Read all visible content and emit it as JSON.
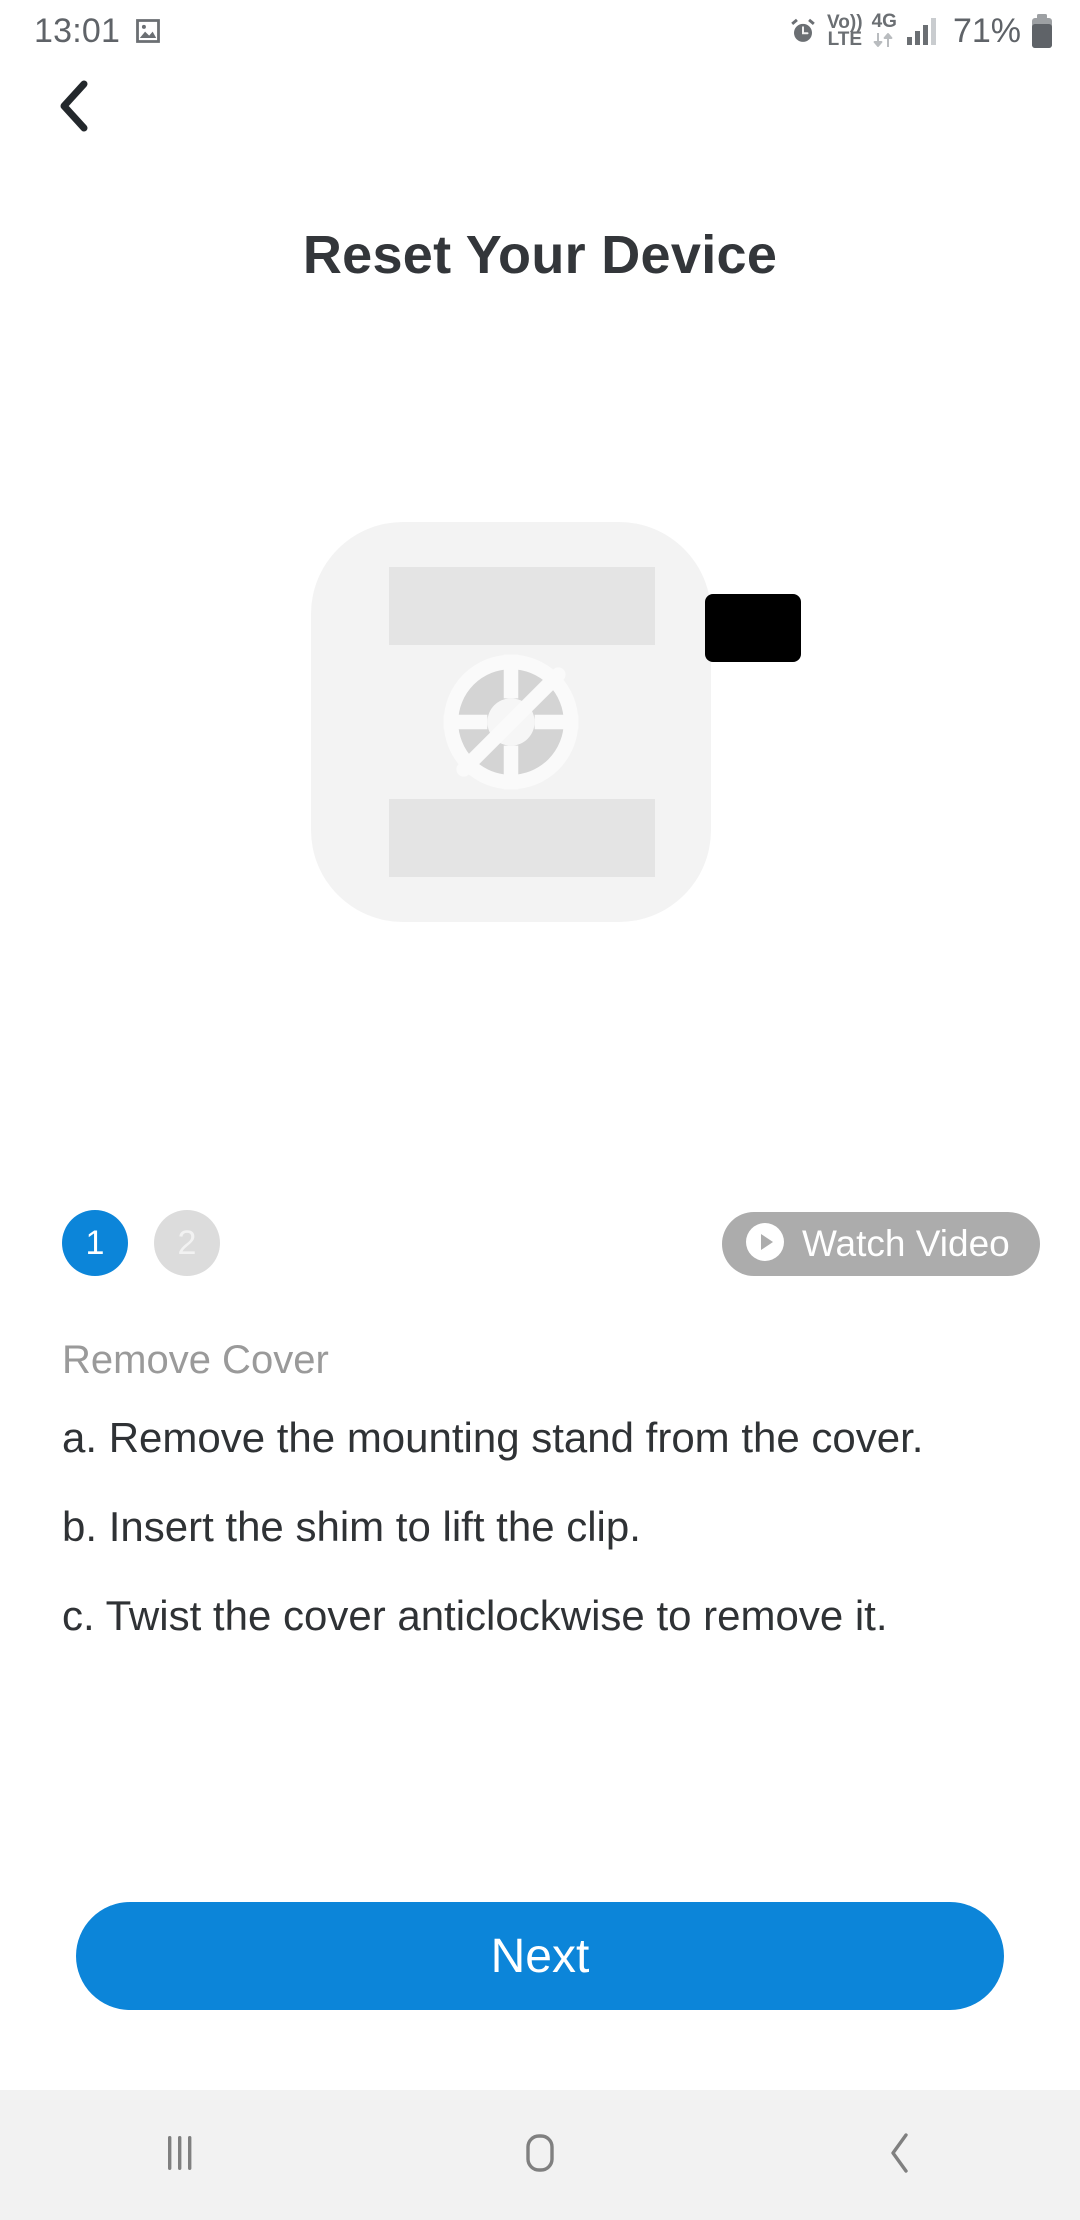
{
  "statusbar": {
    "time": "13:01",
    "gallery_icon": "image-icon",
    "alarm_icon": "alarm-clock-icon",
    "volte_top": "Vo))",
    "volte_bottom": "LTE",
    "network_top": "4G",
    "data_arrows_icon": "data-transfer-icon",
    "signal_icon": "signal-bars-icon",
    "battery_percent": "71%",
    "battery_icon": "battery-icon"
  },
  "navigation": {
    "back_icon": "chevron-left-icon"
  },
  "header": {
    "title": "Reset Your Device"
  },
  "hero": {
    "placeholder_icon": "image-placeholder-icon",
    "spinner_icon": "loading-target-icon",
    "overlay_name": "black-overlay-rect"
  },
  "steps_nav": {
    "dots": [
      {
        "label": "1",
        "state": "active"
      },
      {
        "label": "2",
        "state": "inactive"
      }
    ],
    "watch_video": {
      "label": "Watch Video",
      "icon": "play-circle-icon"
    }
  },
  "instructions": {
    "subtitle": "Remove Cover",
    "items": [
      "a. Remove the mounting stand from the cover.",
      "b. Insert the shim to lift the clip.",
      "c. Twist the cover anticlockwise to remove it."
    ]
  },
  "footer": {
    "next_label": "Next"
  },
  "systemnav": {
    "recents_icon": "recents-icon",
    "home_icon": "home-icon",
    "back_icon": "back-icon"
  },
  "colors": {
    "accent_blue": "#0c85d9",
    "pill_gray": "#acacac",
    "title_gray": "#33363a",
    "subtitle_gray": "#9a9a9a"
  }
}
